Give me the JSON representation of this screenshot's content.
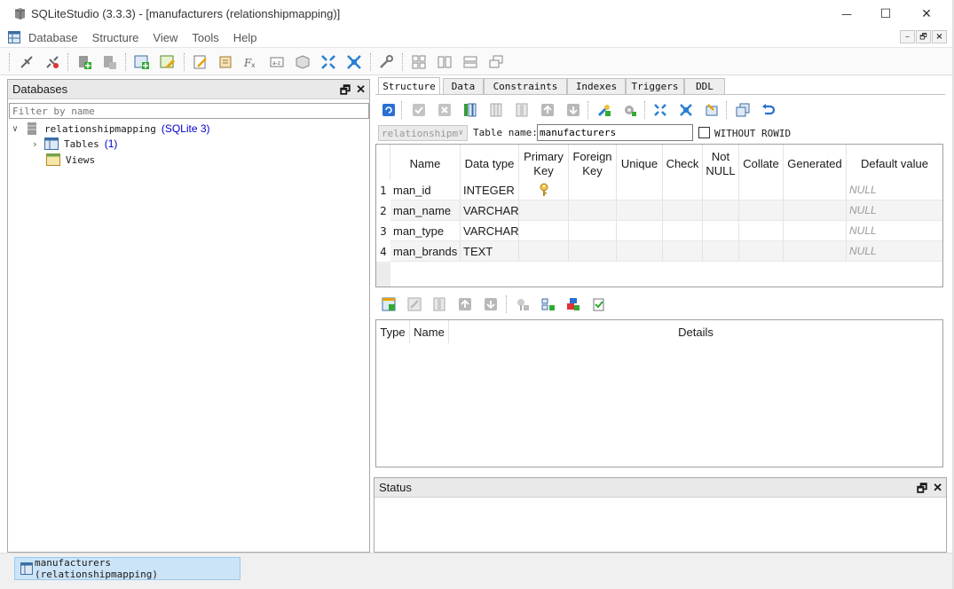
{
  "window": {
    "title": "SQLiteStudio (3.3.3) - [manufacturers (relationshipmapping)]",
    "controls": {
      "minimize": "—",
      "maximize": "☐",
      "close": "✕"
    }
  },
  "menu": [
    "Database",
    "Structure",
    "View",
    "Tools",
    "Help"
  ],
  "mdi_controls": {
    "minimize": "–",
    "restore": "🗗",
    "close": "×"
  },
  "databases_panel": {
    "title": "Databases",
    "filter_placeholder": "Filter by name",
    "tree": {
      "db_name": "relationshipmapping",
      "db_type": "(SQLite 3)",
      "tables_label": "Tables",
      "tables_count": "(1)",
      "views_label": "Views"
    }
  },
  "tabs": [
    "Structure",
    "Data",
    "Constraints",
    "Indexes",
    "Triggers",
    "DDL"
  ],
  "active_tab": "Structure",
  "table_form": {
    "database_combo": "relationshipm",
    "table_name_label": "Table name:",
    "table_name_value": "manufacturers",
    "without_rowid_label": "WITHOUT ROWID",
    "without_rowid_checked": false
  },
  "columns_grid": {
    "headers": [
      "Name",
      "Data type",
      "Primary Key",
      "Foreign Key",
      "Unique",
      "Check",
      "Not NULL",
      "Collate",
      "Generated",
      "Default value"
    ],
    "rows": [
      {
        "num": "1",
        "name": "man_id",
        "type": "INTEGER",
        "pk": true,
        "default": "NULL"
      },
      {
        "num": "2",
        "name": "man_name",
        "type": "VARCHAR",
        "pk": false,
        "default": "NULL"
      },
      {
        "num": "3",
        "name": "man_type",
        "type": "VARCHAR",
        "pk": false,
        "default": "NULL"
      },
      {
        "num": "4",
        "name": "man_brands",
        "type": "TEXT",
        "pk": false,
        "default": "NULL"
      }
    ]
  },
  "constraints_grid": {
    "headers": [
      "Type",
      "Name",
      "Details"
    ]
  },
  "status_panel": {
    "title": "Status"
  },
  "taskbar": {
    "window_button": "manufacturers (relationshipmapping)"
  },
  "colors": {
    "link_blue": "#0000cc",
    "selected_task": "#cce4f7",
    "panel_header": "#e9e9e9"
  }
}
